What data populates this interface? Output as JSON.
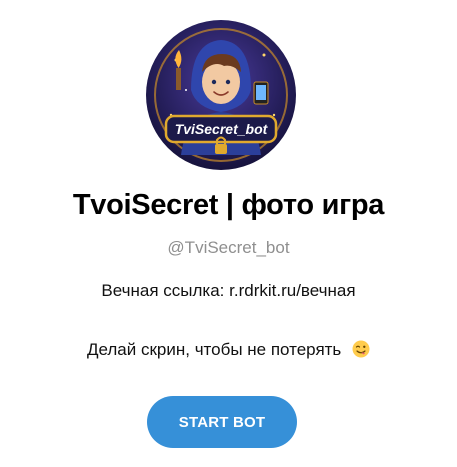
{
  "bot": {
    "title": "TvoiSecret | фото игра",
    "username": "@TviSecret_bot",
    "avatar_badge_text": "TviSecret_bot",
    "avatar_icon": "hooded-boy-avatar"
  },
  "description": {
    "line1": "Вечная ссылка: r.rdrkit.ru/вечная",
    "line2": "Делай скрин, чтобы не потерять",
    "line2_emoji": "winking-face-with-tongue-icon"
  },
  "actions": {
    "start_label": "START BOT"
  },
  "colors": {
    "button": "#3690d8",
    "username": "#8f8f8f",
    "avatar_bg": "#1e1b4e",
    "badge_gold": "#e0a92e"
  }
}
